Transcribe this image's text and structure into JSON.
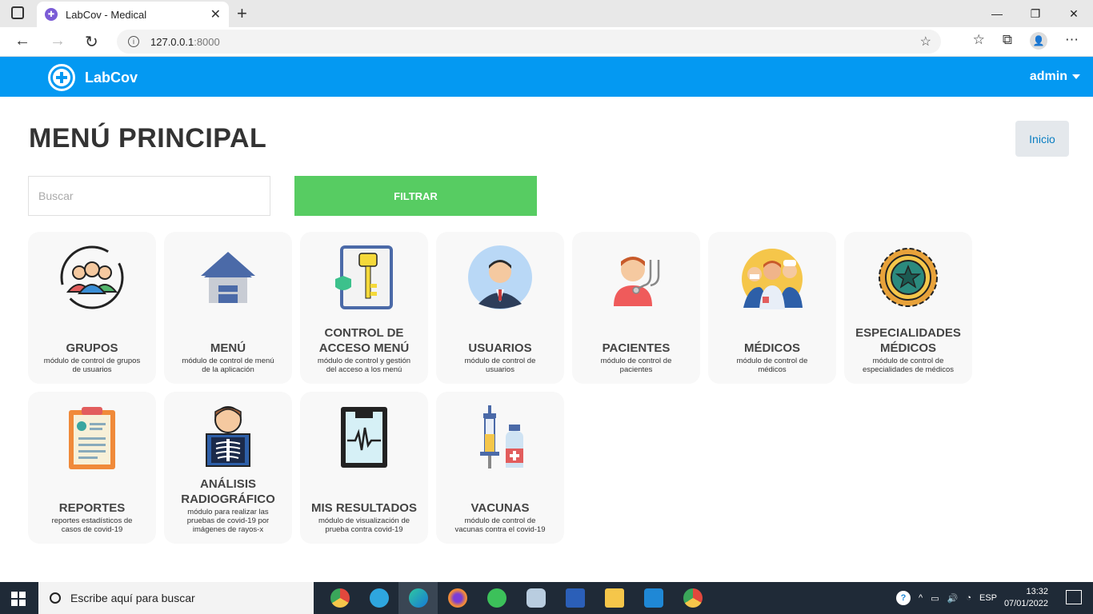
{
  "browser": {
    "tab_title": "LabCov - Medical",
    "url_host": "127.0.0.1",
    "url_port": ":8000"
  },
  "navbar": {
    "brand": "LabCov",
    "user": "admin"
  },
  "page": {
    "title": "MENÚ PRINCIPAL",
    "inicio_label": "Inicio",
    "search_placeholder": "Buscar",
    "filter_label": "FILTRAR"
  },
  "modules": [
    {
      "title": "GRUPOS",
      "desc": "módulo de control de grupos de usuarios",
      "icon": "group-icon"
    },
    {
      "title": "MENÚ",
      "desc": "módulo de control de menú de la aplicación",
      "icon": "house-icon"
    },
    {
      "title": "CONTROL DE ACCESO MENÚ",
      "desc": "módulo de control y gestión del acceso a los menú",
      "icon": "key-icon"
    },
    {
      "title": "USUARIOS",
      "desc": "módulo de control de usuarios",
      "icon": "user-icon"
    },
    {
      "title": "PACIENTES",
      "desc": "módulo de control de pacientes",
      "icon": "patient-icon"
    },
    {
      "title": "MÉDICOS",
      "desc": "módulo de control de médicos",
      "icon": "doctors-icon"
    },
    {
      "title": "ESPECIALIDADES MÉDICOS",
      "desc": "módulo de control de especialidades de médicos",
      "icon": "badge-icon"
    },
    {
      "title": "REPORTES",
      "desc": "reportes estadísticos de casos de covid-19",
      "icon": "clipboard-icon"
    },
    {
      "title": "ANÁLISIS RADIOGRÁFICO",
      "desc": "módulo para realizar las pruebas de covid-19 por imágenes de rayos-x",
      "icon": "xray-icon"
    },
    {
      "title": "MIS RESULTADOS",
      "desc": "módulo de visualización de prueba contra covid-19",
      "icon": "monitor-icon"
    },
    {
      "title": "VACUNAS",
      "desc": "módulo de control de vacunas contra el covid-19",
      "icon": "vaccine-icon"
    }
  ],
  "taskbar": {
    "search_placeholder": "Escribe aquí para buscar",
    "lang": "ESP",
    "time": "13:32",
    "date": "07/01/2022"
  }
}
